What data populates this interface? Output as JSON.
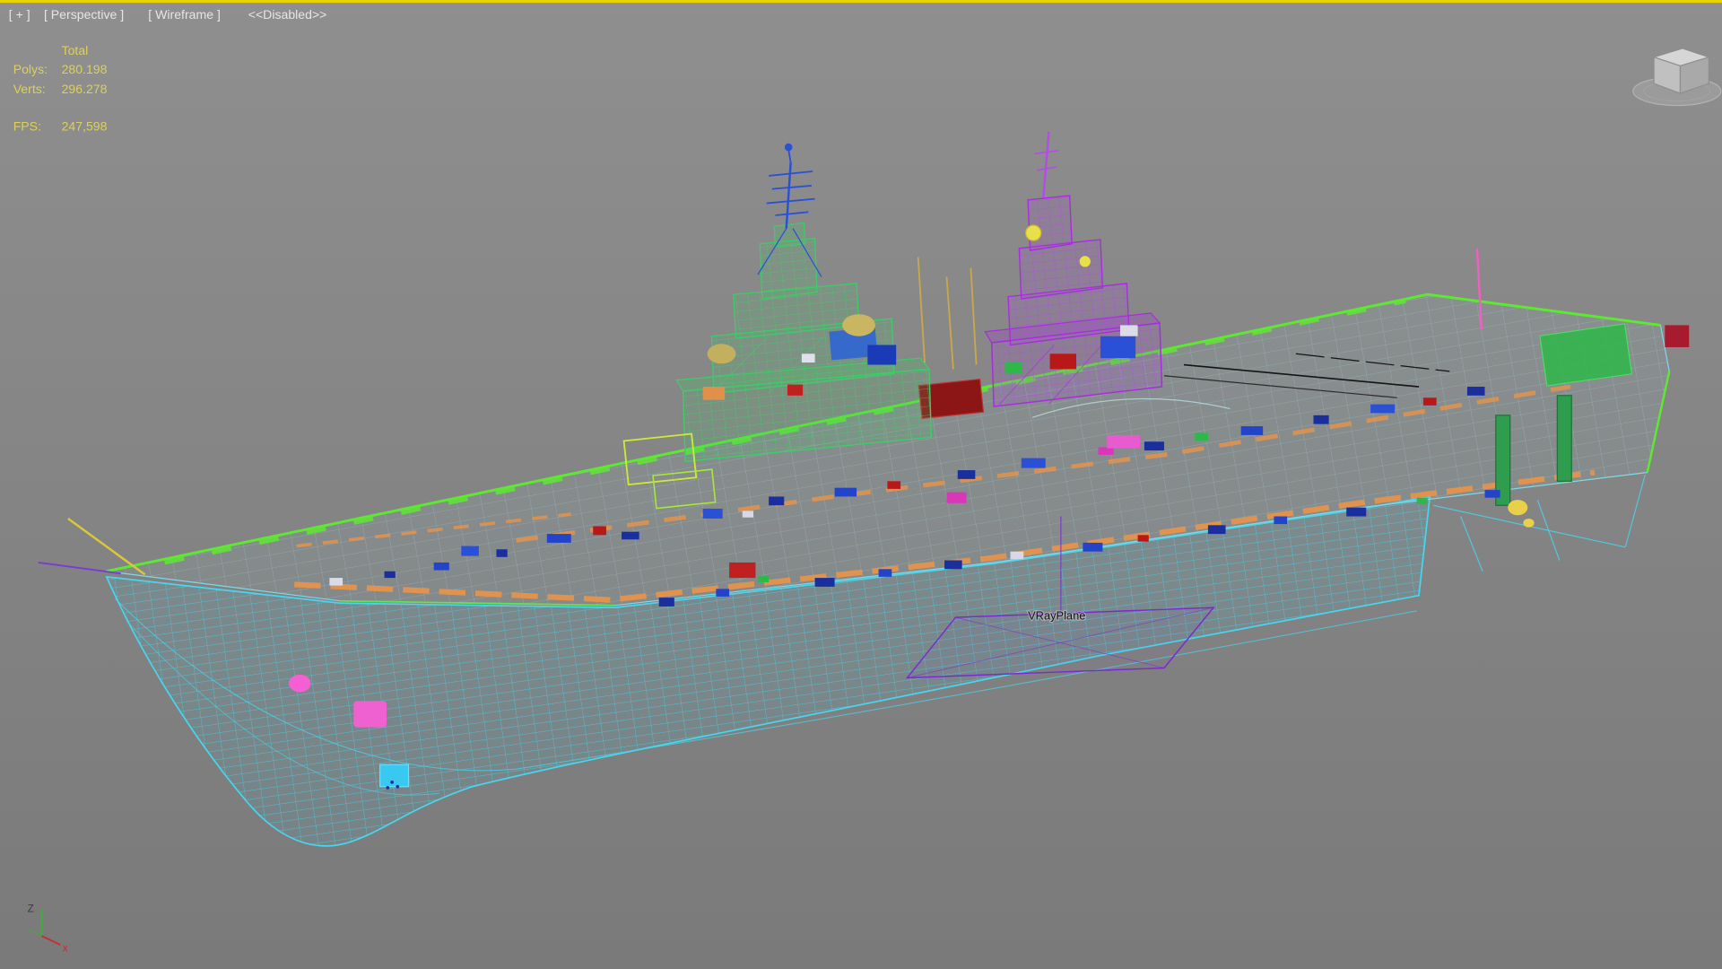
{
  "viewport": {
    "menus": [
      {
        "label": "[ + ]"
      },
      {
        "label": "[ Perspective ]"
      },
      {
        "label": "[ Wireframe ]"
      }
    ],
    "state_note": "<<Disabled>>"
  },
  "statistics": {
    "header": "Total",
    "rows": [
      {
        "label": "Polys:",
        "value": "280.198"
      },
      {
        "label": "Verts:",
        "value": "296.278"
      },
      {
        "label": "FPS:",
        "value": "247,598"
      }
    ]
  },
  "scene": {
    "object_label": "VRayPlane"
  },
  "axis_gizmo": {
    "z_label": "Z",
    "x_label": "x"
  },
  "viewcube": {
    "name": "ViewCube"
  },
  "colors": {
    "active_border": "#e8d400",
    "stats_text": "#ddd05a",
    "hull_cyan": "#46d7ef",
    "deck_edge_green": "#5ee832",
    "walkway_orange": "#e8944a",
    "island_green": "#3ecb6a",
    "island_purple": "#a92be0",
    "mast_blue": "#2a50d8"
  }
}
